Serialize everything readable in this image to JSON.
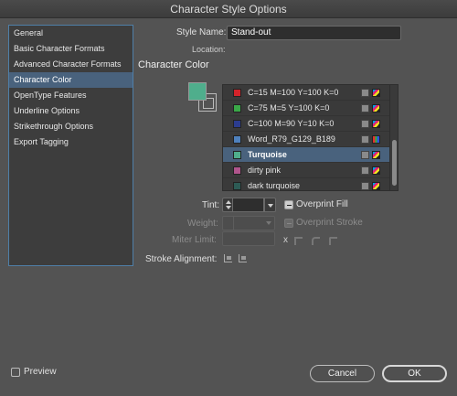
{
  "window": {
    "title": "Character Style Options"
  },
  "sidebar": {
    "items": [
      {
        "label": "General"
      },
      {
        "label": "Basic Character Formats"
      },
      {
        "label": "Advanced Character Formats"
      },
      {
        "label": "Character Color",
        "selected": true
      },
      {
        "label": "OpenType Features"
      },
      {
        "label": "Underline Options"
      },
      {
        "label": "Strikethrough Options"
      },
      {
        "label": "Export Tagging"
      }
    ]
  },
  "general": {
    "style_name_label": "Style Name:",
    "style_name_value": "Stand-out",
    "location_label": "Location:"
  },
  "character_color": {
    "section_title": "Character Color",
    "swatches": [
      {
        "name": "C=15 M=100 Y=100 K=0",
        "color": "#d2232a",
        "mode": "cmyk"
      },
      {
        "name": "C=75 M=5 Y=100 K=0",
        "color": "#3aa848",
        "mode": "cmyk"
      },
      {
        "name": "C=100 M=90 Y=10 K=0",
        "color": "#2b3c8f",
        "mode": "cmyk"
      },
      {
        "name": "Word_R79_G129_B189",
        "color": "#4f81bd",
        "mode": "rgb"
      },
      {
        "name": "Turquoise",
        "color": "#4fae8c",
        "mode": "cmyk",
        "selected": true
      },
      {
        "name": "dirty pink",
        "color": "#b0558c",
        "mode": "cmyk"
      },
      {
        "name": "dark turquoise",
        "color": "#2d5b55",
        "mode": "cmyk"
      }
    ],
    "tint_label": "Tint:",
    "tint_value": "",
    "overprint_fill_label": "Overprint Fill",
    "weight_label": "Weight:",
    "overprint_stroke_label": "Overprint Stroke",
    "miter_label": "Miter Limit:",
    "miter_suffix": "x",
    "stroke_alignment_label": "Stroke Alignment:"
  },
  "footer": {
    "preview_label": "Preview",
    "cancel_label": "Cancel",
    "ok_label": "OK"
  }
}
